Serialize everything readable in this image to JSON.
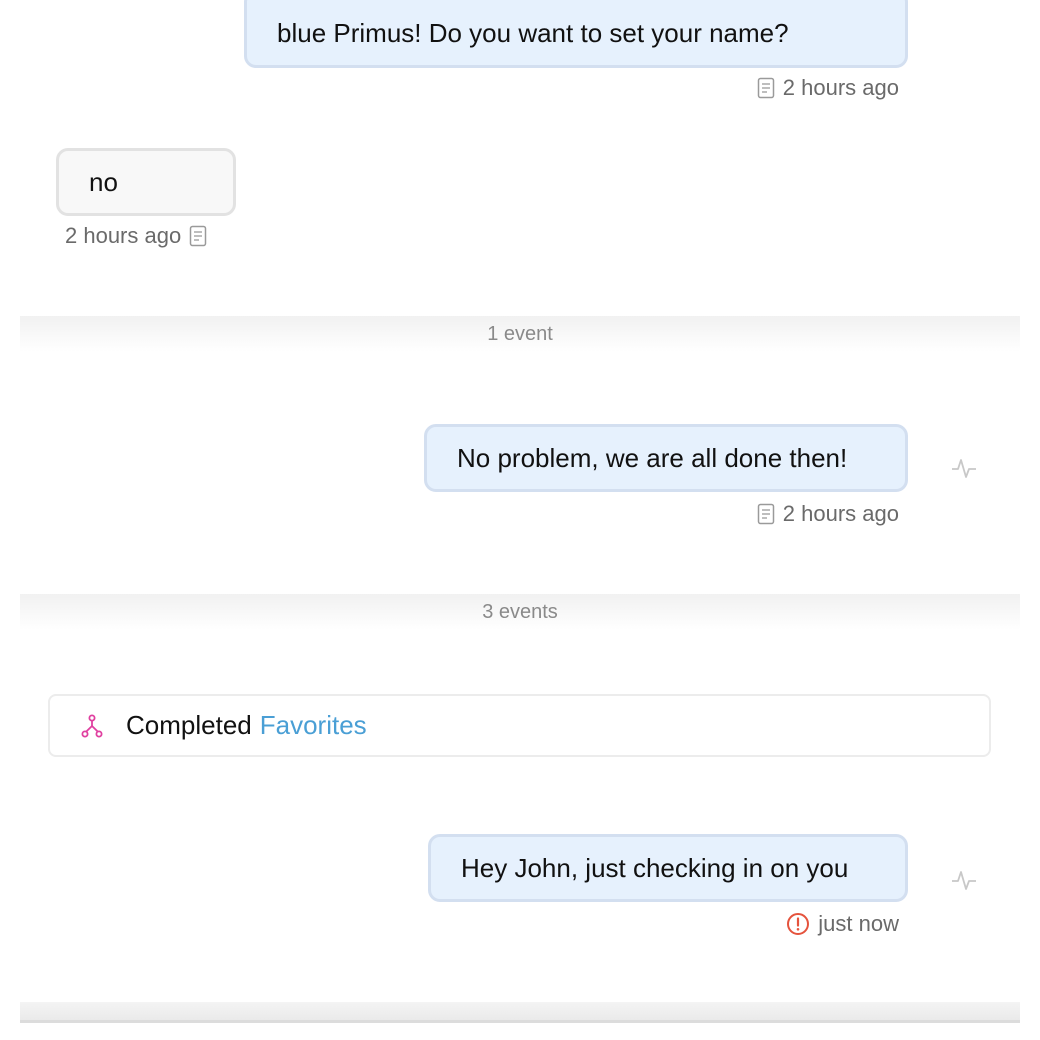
{
  "messages": [
    {
      "text": "blue Primus! Do you want to set your name?",
      "time": "2 hours ago"
    },
    {
      "text": "no",
      "time": "2 hours ago"
    },
    {
      "text": "No problem, we are all done then!",
      "time": "2 hours ago"
    },
    {
      "text": "Hey John, just checking in on you",
      "time": "just now"
    }
  ],
  "events": [
    {
      "label": "1 event"
    },
    {
      "label": "3 events"
    }
  ],
  "completed": {
    "label": "Completed",
    "link": "Favorites"
  },
  "icons": {
    "doc": "document-icon",
    "activity": "activity-icon",
    "flow": "flow-icon",
    "error": "error-circle-icon"
  },
  "colors": {
    "outgoing_bg": "#e6f1fd",
    "incoming_bg": "#f8f8f8",
    "link": "#4a9fd5",
    "flow_icon": "#e040a0",
    "error": "#e5533d"
  }
}
